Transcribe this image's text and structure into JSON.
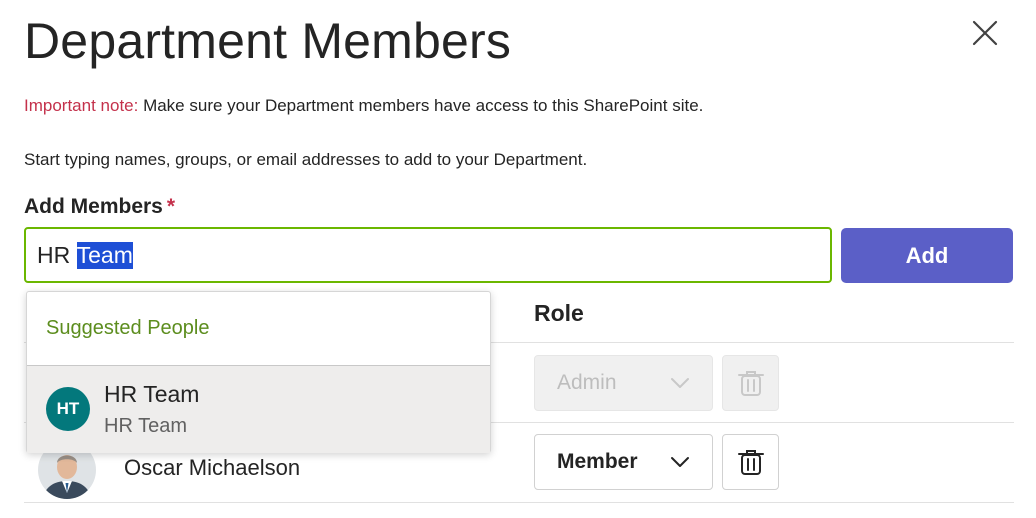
{
  "dialog": {
    "title": "Department Members",
    "note_prefix": "Important note:",
    "note_text": " Make sure your Department members have access to this SharePoint site.",
    "hint": "Start typing names, groups, or email addresses to add to your Department."
  },
  "add_members": {
    "label": "Add Members",
    "required_mark": "*",
    "value_plain": "HR ",
    "value_selected": "Team",
    "add_button": "Add"
  },
  "table": {
    "role_header": "Role",
    "rows": [
      {
        "name": "",
        "role": "Admin",
        "disabled": true
      },
      {
        "name": "Oscar Michaelson",
        "role": "Member",
        "disabled": false
      }
    ]
  },
  "suggestions": {
    "header": "Suggested People",
    "items": [
      {
        "initials": "HT",
        "name": "HR Team",
        "subtitle": "HR Team"
      }
    ]
  },
  "colors": {
    "accent": "#5b5fc7",
    "focus_border": "#6bb700",
    "important": "#c4314b",
    "suggest_header": "#5c8d1e",
    "avatar_teal": "#03787c"
  },
  "icons": {
    "close": "close-icon",
    "chevron": "chevron-down-icon",
    "delete": "trash-icon"
  }
}
